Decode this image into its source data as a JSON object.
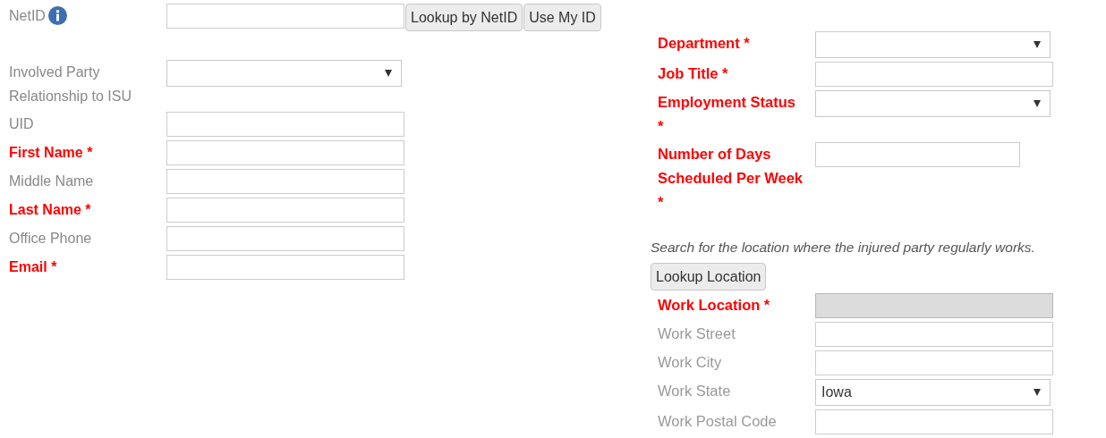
{
  "left": {
    "netid": {
      "label": "NetID",
      "info": true,
      "buttons": [
        "Lookup by NetID",
        "Use My ID"
      ]
    },
    "fields": [
      {
        "label": "Involved Party Relationship to ISU",
        "required": false,
        "kind": "select"
      },
      {
        "label": "UID",
        "required": false,
        "kind": "text"
      },
      {
        "label": "First Name *",
        "required": true,
        "kind": "text"
      },
      {
        "label": "Middle Name",
        "required": false,
        "kind": "text"
      },
      {
        "label": "Last Name *",
        "required": true,
        "kind": "text"
      },
      {
        "label": "Office Phone",
        "required": false,
        "kind": "text"
      },
      {
        "label": "Email *",
        "required": true,
        "kind": "text"
      }
    ]
  },
  "right": {
    "fields": [
      {
        "label": "Department *",
        "required": true,
        "kind": "select"
      },
      {
        "label": "Job Title *",
        "required": true,
        "kind": "text"
      },
      {
        "label": "Employment Status *",
        "required": true,
        "kind": "select"
      },
      {
        "label": "Number of Days Scheduled Per Week *",
        "required": true,
        "kind": "short"
      }
    ],
    "hint": "Search for the location where the injured party regularly works.",
    "lookup_button": "Lookup Location",
    "location_fields": [
      {
        "label": "Work Location *",
        "required": true,
        "kind": "text",
        "disabled": true
      },
      {
        "label": "Work Street",
        "required": false,
        "kind": "text",
        "disabled": false
      },
      {
        "label": "Work City",
        "required": false,
        "kind": "text",
        "disabled": false
      },
      {
        "label": "Work State",
        "required": false,
        "kind": "select",
        "value": "Iowa",
        "disabled": false
      },
      {
        "label": "Work Postal Code",
        "required": false,
        "kind": "text",
        "disabled": false
      }
    ]
  }
}
